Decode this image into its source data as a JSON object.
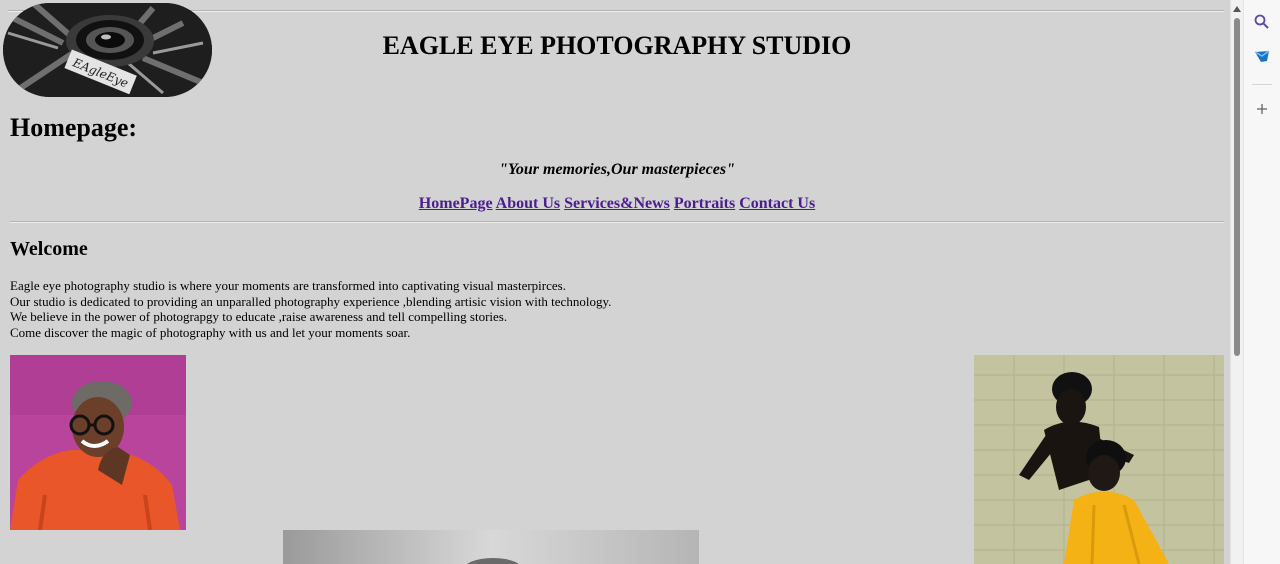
{
  "header": {
    "title": "EAGLE EYE PHOTOGRAPHY STUDIO",
    "logo_text": "EAgleEye"
  },
  "page": {
    "heading": "Homepage:",
    "tagline": "\"Your memories,Our masterpieces\""
  },
  "nav": {
    "items": [
      {
        "label": "HomePage"
      },
      {
        "label": "About Us"
      },
      {
        "label": "Services&News"
      },
      {
        "label": "Portraits"
      },
      {
        "label": "Contact Us"
      }
    ]
  },
  "welcome": {
    "heading": "Welcome",
    "lines": [
      "Eagle eye photography studio is where your moments are transformed into captivating visual masterpirces.",
      "Our studio is dedicated to providing an unparalled photography experience ,blending artisic vision with technology.",
      "We believe in the power of photograpgy to educate ,raise awareness and tell compelling stories.",
      "Come discover the magic of photography with us and let your moments soar."
    ]
  },
  "colors": {
    "page_background": "#d3d3d3",
    "link": "#4b1d8f",
    "portrait_left_background": "#b8449c",
    "portrait_left_sweater": "#e8562a",
    "portrait_right_wall": "#c4c3a0",
    "portrait_right_cape": "#f4b214"
  },
  "browser_sidebar": {
    "icons": [
      "search-icon",
      "outlook-icon",
      "add-icon"
    ]
  }
}
